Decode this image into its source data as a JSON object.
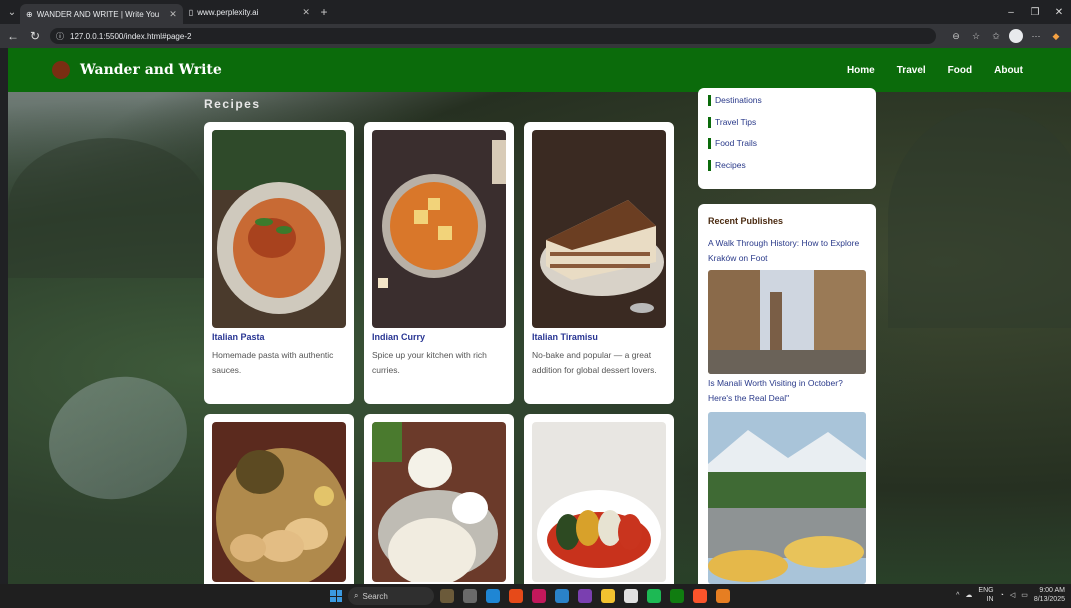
{
  "browser": {
    "tabs": [
      {
        "title": "WANDER AND WRITE | Write You",
        "active": true
      },
      {
        "title": "www.perplexity.ai",
        "active": false
      }
    ],
    "url": "127.0.0.1:5500/index.html#page-2"
  },
  "site": {
    "brand": "Wander and Write",
    "nav": [
      "Home",
      "Travel",
      "Food",
      "About"
    ],
    "section_title": "Recipes",
    "recipes": [
      {
        "title": "Italian Pasta",
        "desc": "Homemade pasta with authentic sauces."
      },
      {
        "title": "Indian Curry",
        "desc": "Spice up your kitchen with rich curries."
      },
      {
        "title": "Italian Tiramisu",
        "desc": "No-bake and popular — a great addition for global dessert lovers."
      },
      {
        "title": "",
        "desc": ""
      },
      {
        "title": "",
        "desc": ""
      },
      {
        "title": "",
        "desc": ""
      }
    ],
    "categories": [
      "Destinations",
      "Travel Tips",
      "Food Trails",
      "Recipes"
    ],
    "recent": {
      "heading": "Recent Publishes",
      "posts": [
        {
          "title": "A Walk Through History: How to Explore Kraków on Foot"
        },
        {
          "title": "Is Manali Worth Visiting in October? Here's the Real Deal\""
        }
      ]
    }
  },
  "taskbar": {
    "search_placeholder": "Search",
    "lang_top": "ENG",
    "lang_bottom": "IN",
    "time": "9:00 AM",
    "date": "8/13/2025"
  },
  "colors": {
    "navbar": "#0b6b0b",
    "link": "#283593",
    "accent": "#0b6b0b"
  }
}
